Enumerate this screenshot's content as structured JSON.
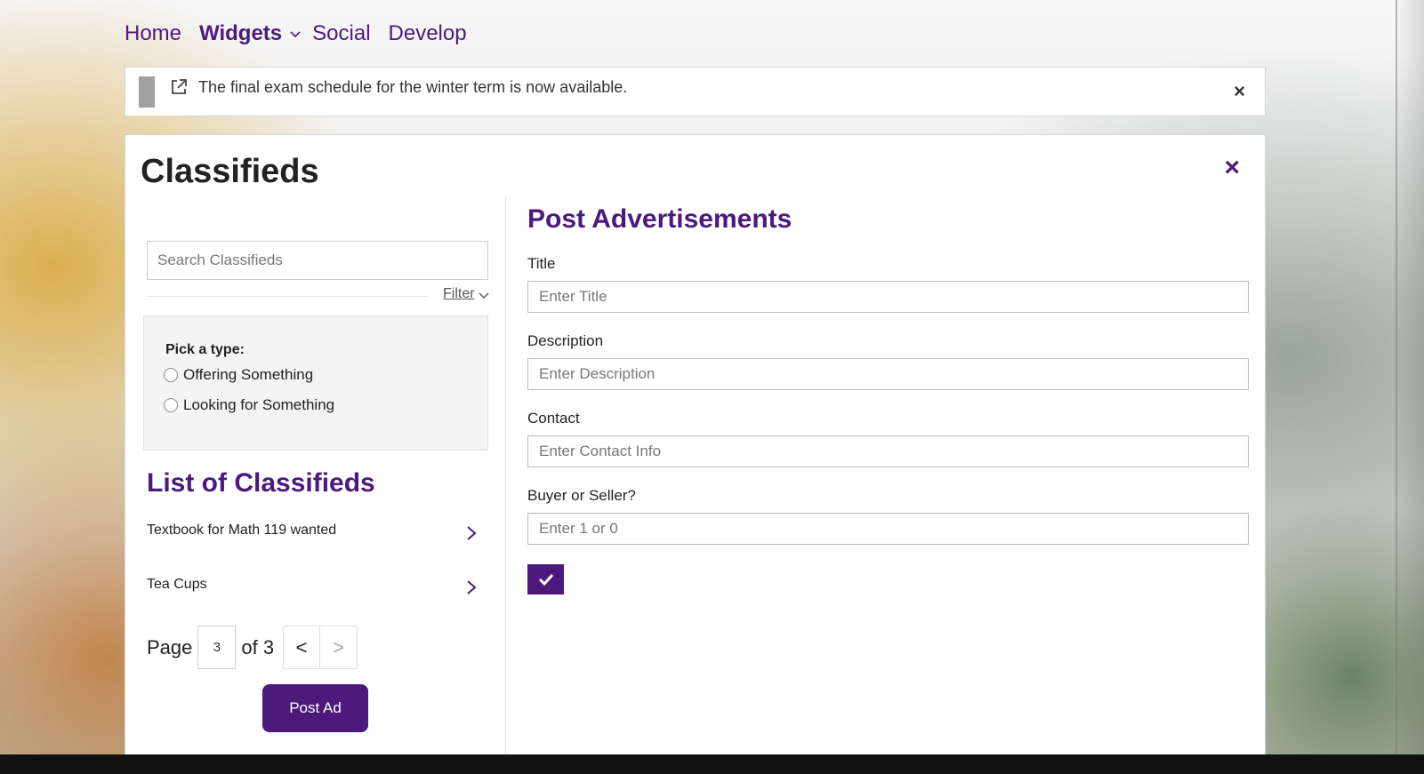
{
  "nav": {
    "items": [
      {
        "label": "Home"
      },
      {
        "label": "Widgets"
      },
      {
        "label": "Social"
      },
      {
        "label": "Develop"
      }
    ]
  },
  "alert": {
    "text": "The final exam schedule for the winter term is now available.",
    "close": "×"
  },
  "panel": {
    "title": "Classifieds",
    "close": "×"
  },
  "search": {
    "placeholder": "Search Classifieds",
    "filter_label": "Filter"
  },
  "filter": {
    "label": "Pick a type:",
    "options": [
      {
        "label": "Offering Something"
      },
      {
        "label": "Looking for Something"
      }
    ]
  },
  "list": {
    "title": "List of Classifieds",
    "items": [
      {
        "label": "Textbook for Math 119 wanted"
      },
      {
        "label": "Tea Cups"
      }
    ]
  },
  "pager": {
    "label": "Page",
    "current": "3",
    "of_text": "of 3",
    "prev": "<",
    "next": ">"
  },
  "post_button": "Post Ad",
  "form": {
    "title": "Post Advertisements",
    "title_label": "Title",
    "title_placeholder": "Enter Title",
    "description_label": "Description",
    "description_placeholder": "Enter Description",
    "contact_label": "Contact",
    "contact_placeholder": "Enter Contact Info",
    "buyer_label": "Buyer or Seller?",
    "buyer_placeholder": "Enter 1 or 0"
  },
  "colors": {
    "accent": "#4b1a7c"
  }
}
